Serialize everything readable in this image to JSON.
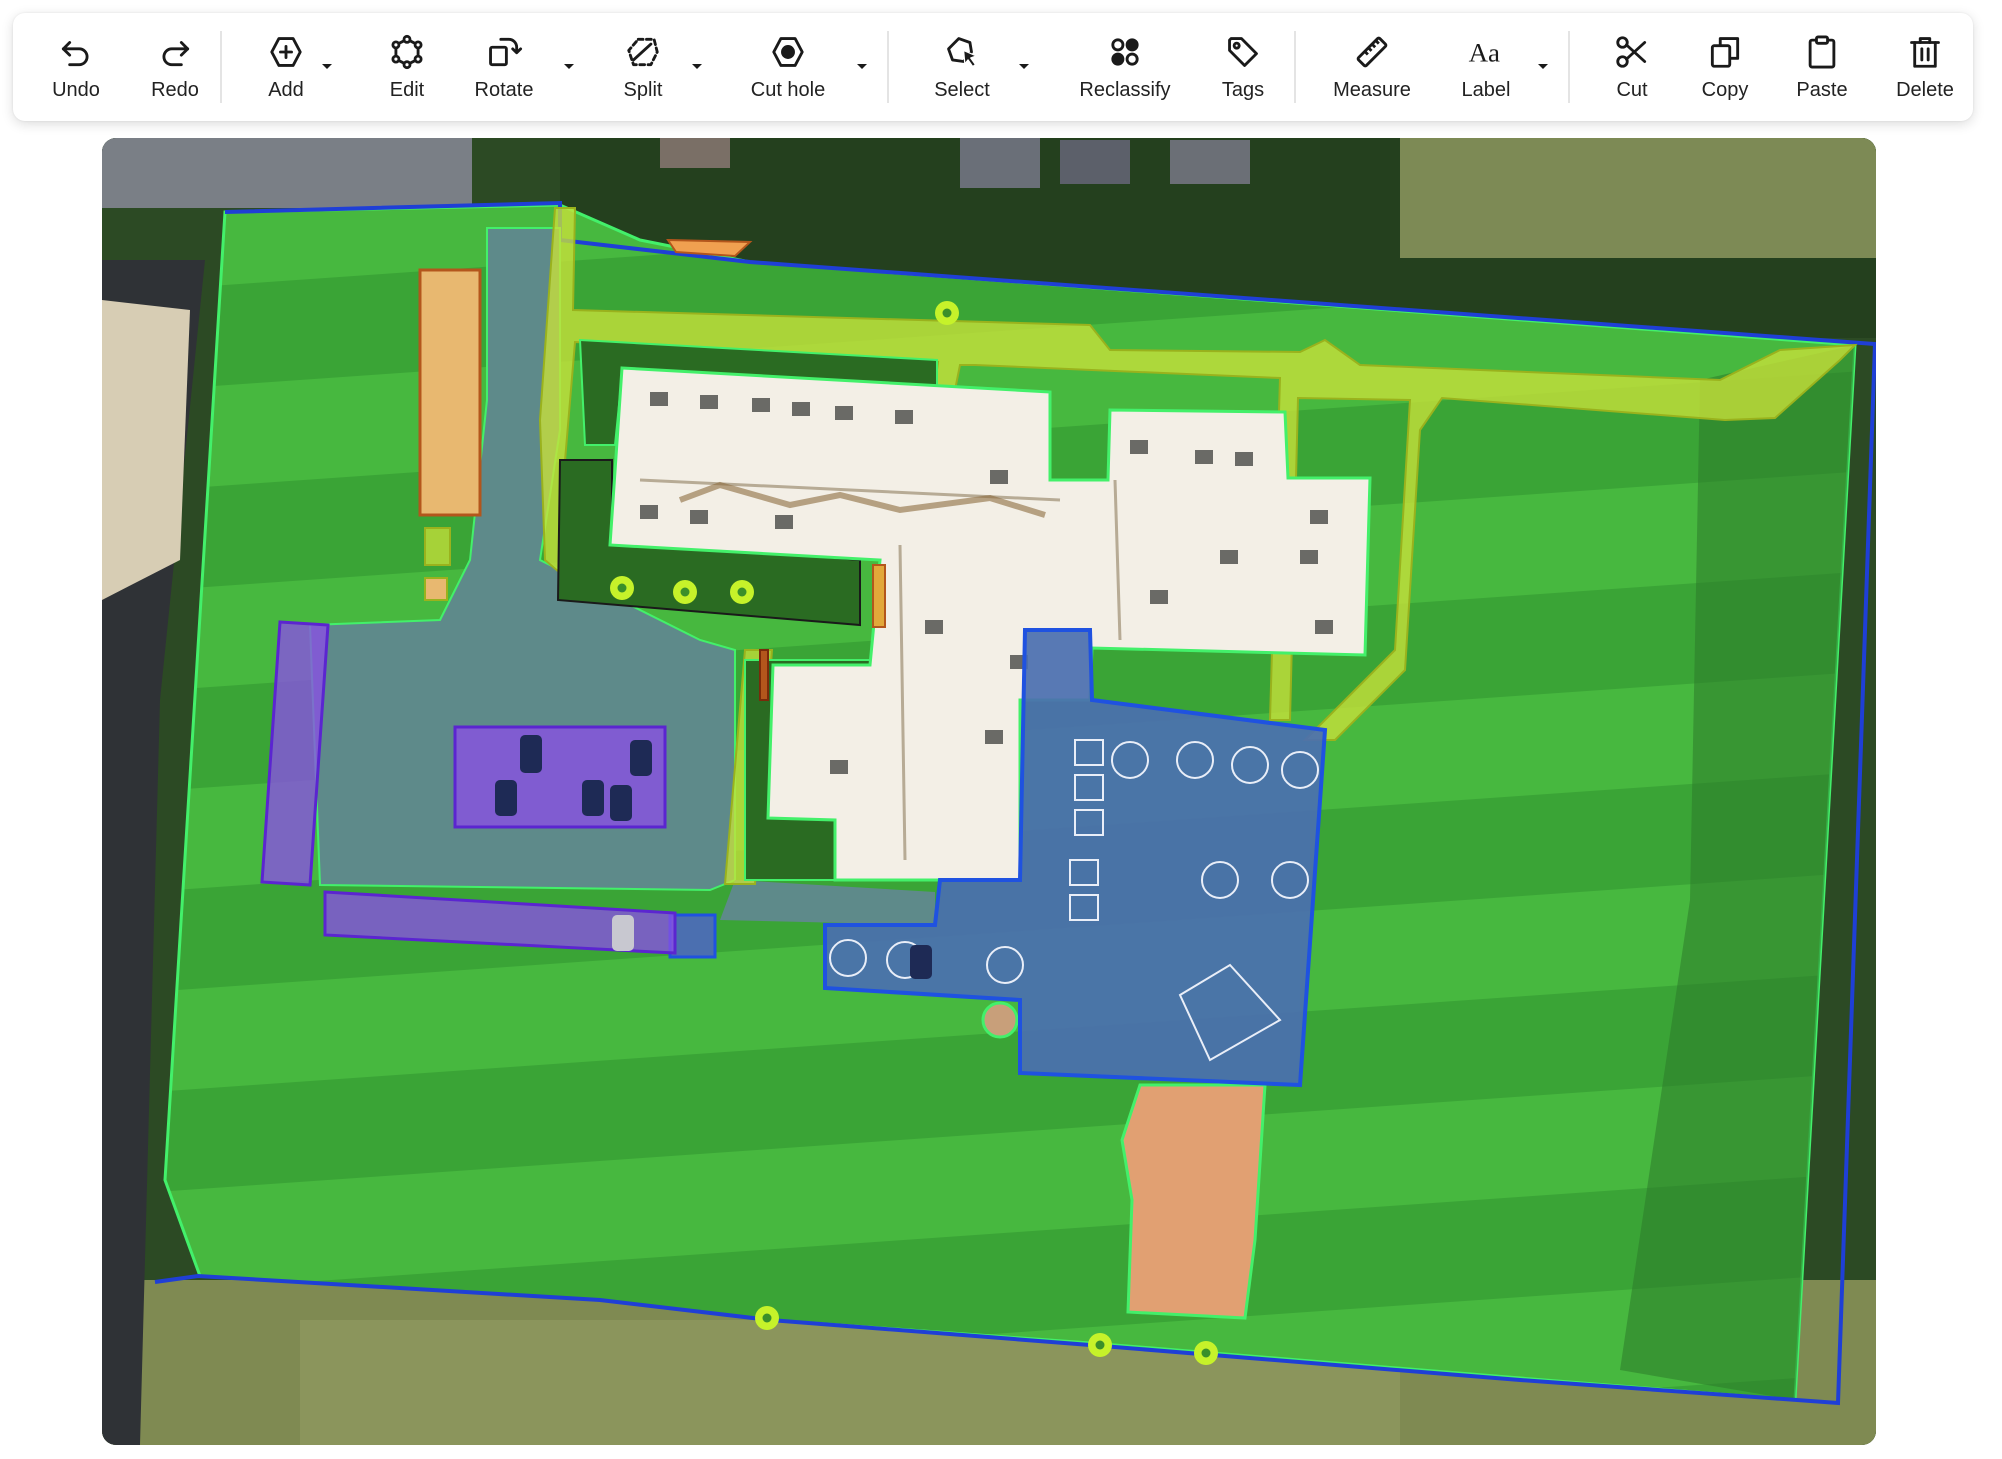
{
  "toolbar": {
    "undo": "Undo",
    "redo": "Redo",
    "add": "Add",
    "edit": "Edit",
    "rotate": "Rotate",
    "split": "Split",
    "cut_hole": "Cut hole",
    "select": "Select",
    "reclassify": "Reclassify",
    "tags": "Tags",
    "measure": "Measure",
    "label": "Label",
    "cut": "Cut",
    "copy": "Copy",
    "paste": "Paste",
    "delete": "Delete",
    "label_icon_text": "Aa"
  },
  "icons": {
    "undo": "undo-icon",
    "redo": "redo-icon",
    "add": "add-icon",
    "edit": "edit-icon",
    "rotate": "rotate-icon",
    "split": "split-icon",
    "cut_hole": "cut-hole-icon",
    "select": "select-icon",
    "reclassify": "reclassify-icon",
    "tags": "tag-icon",
    "measure": "ruler-icon",
    "label": "label-icon",
    "cut": "scissors-icon",
    "copy": "copy-icon",
    "paste": "paste-icon",
    "delete": "trash-icon",
    "dropdown": "chevron-down-icon"
  },
  "colors": {
    "turf": "#3fb93a",
    "turf_outline": "#43f06a",
    "property_line": "#1f3fd6",
    "hardscape_blue": "#3b63d8",
    "parking": "#8a4fe6",
    "walkway": "#c8e23a",
    "mulch": "#f0a050",
    "roof": "#f3efe6",
    "tree_marker": "#c6f22a"
  }
}
